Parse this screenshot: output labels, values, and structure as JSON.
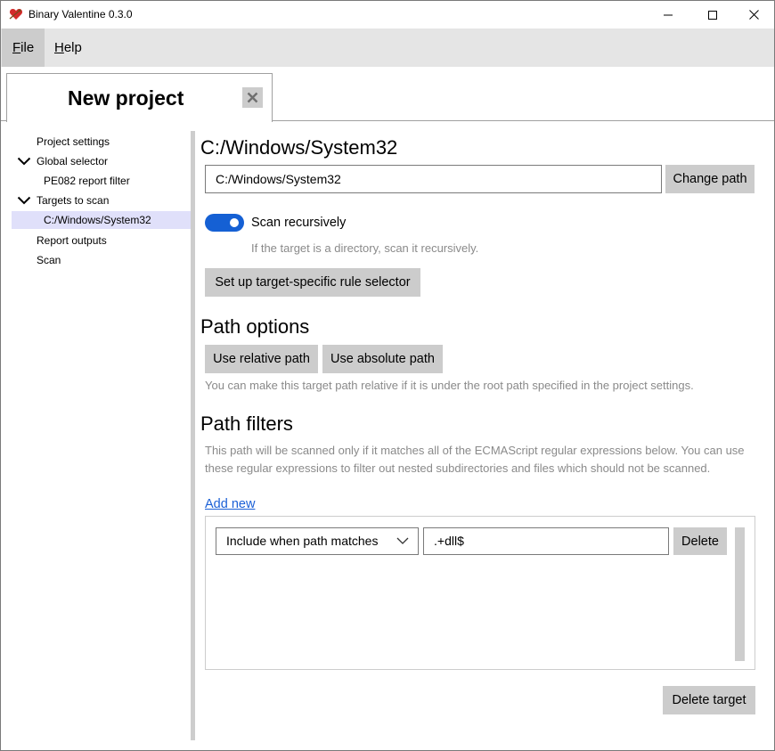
{
  "window": {
    "title": "Binary Valentine 0.3.0",
    "icon": "heart-icon",
    "accent_color": "#1560d4"
  },
  "menu": {
    "file_mnemonic": "F",
    "file_rest": "ile",
    "help_mnemonic": "H",
    "help_rest": "elp"
  },
  "tab": {
    "title": "New project"
  },
  "sidebar": {
    "items": [
      {
        "label": "Project settings"
      },
      {
        "label": "Global selector"
      },
      {
        "label": "PE082 report filter"
      },
      {
        "label": "Targets to scan"
      },
      {
        "label": "C:/Windows/System32"
      },
      {
        "label": "Report outputs"
      },
      {
        "label": "Scan"
      }
    ]
  },
  "target": {
    "heading": "C:/Windows/System32",
    "path_value": "C:/Windows/System32",
    "change_path_label": "Change path",
    "scan_recursively_label": "Scan recursively",
    "scan_recursively_on": true,
    "scan_recursively_hint": "If the target is a directory, scan it recursively.",
    "rule_selector_label": "Set up target-specific rule selector"
  },
  "path_options": {
    "heading": "Path options",
    "relative_label": "Use relative path",
    "absolute_label": "Use absolute path",
    "hint": "You can make this target path relative if it is under the root path specified in the project settings."
  },
  "path_filters": {
    "heading": "Path filters",
    "hint": "This path will be scanned only if it matches all of the ECMAScript regular expressions below. You can use these regular expressions to filter out nested subdirectories and files which should not be scanned.",
    "add_new_label": "Add new",
    "rows": [
      {
        "mode": "Include when path matches",
        "regex": ".+dll$",
        "delete_label": "Delete"
      }
    ]
  },
  "actions": {
    "delete_target_label": "Delete target"
  }
}
